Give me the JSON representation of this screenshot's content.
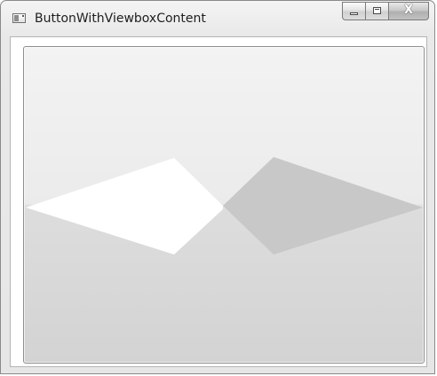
{
  "window": {
    "title": "ButtonWithViewboxContent"
  },
  "caption_buttons": {
    "close_glyph": "X"
  },
  "colors": {
    "left_shape": "#ffffff",
    "right_shape": "#c8c8c8",
    "overlap_shape": "#dddddd"
  },
  "icons": {
    "app": "app-window-icon",
    "minimize": "minimize-icon",
    "maximize": "maximize-icon",
    "close": "close-icon"
  }
}
